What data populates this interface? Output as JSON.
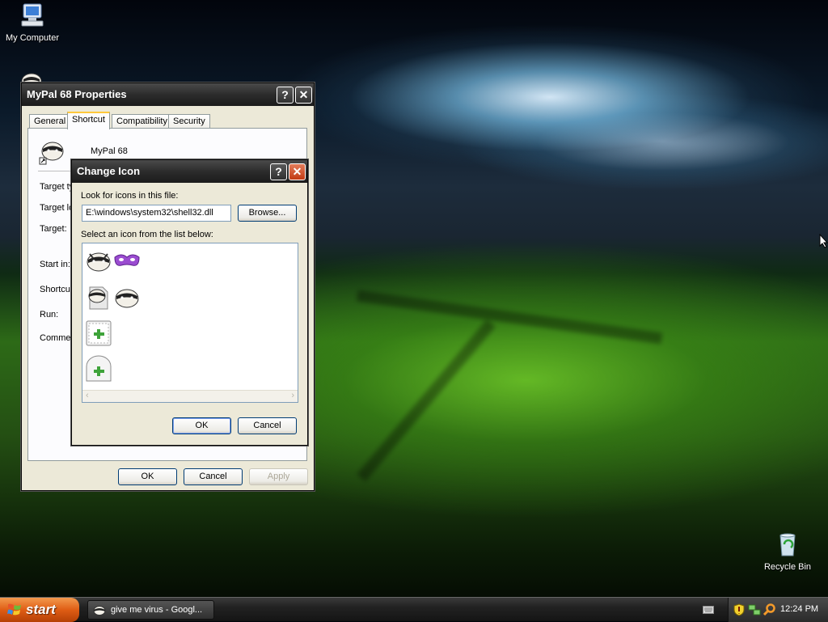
{
  "desktop": {
    "icons": [
      {
        "label": "My Computer",
        "icon": "my-computer-icon"
      },
      {
        "label": "Recycle Bin",
        "icon": "recycle-bin-icon"
      }
    ]
  },
  "properties_window": {
    "title": "MyPal 68 Properties",
    "help_button": "?",
    "close_button": "✕",
    "tabs": [
      "General",
      "Shortcut",
      "Compatibility",
      "Security"
    ],
    "active_tab": "Shortcut",
    "app_name": "MyPal 68",
    "field_labels": [
      "Target ty",
      "Target lo",
      "Target:",
      "Start in:",
      "Shortcu",
      "Run:",
      "Commer"
    ],
    "buttons": {
      "ok": "OK",
      "cancel": "Cancel",
      "apply": "Apply"
    }
  },
  "change_icon_dialog": {
    "title": "Change Icon",
    "help_button": "?",
    "close_button": "✕",
    "look_for_label": "Look for icons in this file:",
    "file_path": "E:\\windows\\system32\\shell32.dll",
    "browse_button": "Browse...",
    "select_label": "Select an icon from the list below:",
    "icons": [
      "raccoon-icon",
      "mask-icon",
      "raccoon-document-icon",
      "raccoon-icon-2",
      "add-page-icon",
      "add-profile-icon"
    ],
    "buttons": {
      "ok": "OK",
      "cancel": "Cancel"
    }
  },
  "taskbar": {
    "start_label": "start",
    "task_label": "give me virus - Googl...",
    "clock": "12:24 PM"
  },
  "colors": {
    "accent_orange": "#df5d14",
    "titlebar_dark": "#2c2c2c",
    "close_red": "#c23a13",
    "tab_highlight": "#ffc83c"
  }
}
